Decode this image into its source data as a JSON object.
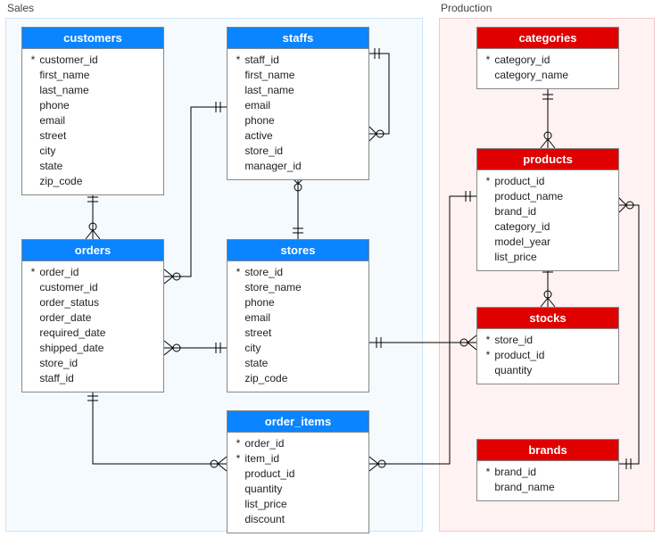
{
  "regions": {
    "sales": {
      "label": "Sales"
    },
    "production": {
      "label": "Production"
    }
  },
  "entities": {
    "customers": {
      "title": "customers",
      "columns": [
        {
          "pk": true,
          "name": "customer_id"
        },
        {
          "pk": false,
          "name": "first_name"
        },
        {
          "pk": false,
          "name": "last_name"
        },
        {
          "pk": false,
          "name": "phone"
        },
        {
          "pk": false,
          "name": "email"
        },
        {
          "pk": false,
          "name": "street"
        },
        {
          "pk": false,
          "name": "city"
        },
        {
          "pk": false,
          "name": "state"
        },
        {
          "pk": false,
          "name": "zip_code"
        }
      ]
    },
    "staffs": {
      "title": "staffs",
      "columns": [
        {
          "pk": true,
          "name": "staff_id"
        },
        {
          "pk": false,
          "name": "first_name"
        },
        {
          "pk": false,
          "name": "last_name"
        },
        {
          "pk": false,
          "name": "email"
        },
        {
          "pk": false,
          "name": "phone"
        },
        {
          "pk": false,
          "name": "active"
        },
        {
          "pk": false,
          "name": "store_id"
        },
        {
          "pk": false,
          "name": "manager_id"
        }
      ]
    },
    "orders": {
      "title": "orders",
      "columns": [
        {
          "pk": true,
          "name": "order_id"
        },
        {
          "pk": false,
          "name": "customer_id"
        },
        {
          "pk": false,
          "name": "order_status"
        },
        {
          "pk": false,
          "name": "order_date"
        },
        {
          "pk": false,
          "name": "required_date"
        },
        {
          "pk": false,
          "name": "shipped_date"
        },
        {
          "pk": false,
          "name": "store_id"
        },
        {
          "pk": false,
          "name": "staff_id"
        }
      ]
    },
    "stores": {
      "title": "stores",
      "columns": [
        {
          "pk": true,
          "name": "store_id"
        },
        {
          "pk": false,
          "name": "store_name"
        },
        {
          "pk": false,
          "name": "phone"
        },
        {
          "pk": false,
          "name": "email"
        },
        {
          "pk": false,
          "name": "street"
        },
        {
          "pk": false,
          "name": "city"
        },
        {
          "pk": false,
          "name": "state"
        },
        {
          "pk": false,
          "name": "zip_code"
        }
      ]
    },
    "order_items": {
      "title": "order_items",
      "columns": [
        {
          "pk": true,
          "name": "order_id"
        },
        {
          "pk": true,
          "name": "item_id"
        },
        {
          "pk": false,
          "name": "product_id"
        },
        {
          "pk": false,
          "name": "quantity"
        },
        {
          "pk": false,
          "name": "list_price"
        },
        {
          "pk": false,
          "name": "discount"
        }
      ]
    },
    "categories": {
      "title": "categories",
      "columns": [
        {
          "pk": true,
          "name": "category_id"
        },
        {
          "pk": false,
          "name": "category_name"
        }
      ]
    },
    "products": {
      "title": "products",
      "columns": [
        {
          "pk": true,
          "name": "product_id"
        },
        {
          "pk": false,
          "name": "product_name"
        },
        {
          "pk": false,
          "name": "brand_id"
        },
        {
          "pk": false,
          "name": "category_id"
        },
        {
          "pk": false,
          "name": "model_year"
        },
        {
          "pk": false,
          "name": "list_price"
        }
      ]
    },
    "stocks": {
      "title": "stocks",
      "columns": [
        {
          "pk": true,
          "name": "store_id"
        },
        {
          "pk": true,
          "name": "product_id"
        },
        {
          "pk": false,
          "name": "quantity"
        }
      ]
    },
    "brands": {
      "title": "brands",
      "columns": [
        {
          "pk": true,
          "name": "brand_id"
        },
        {
          "pk": false,
          "name": "brand_name"
        }
      ]
    }
  },
  "relationships": [
    {
      "from": "customers",
      "to": "orders",
      "type": "one-to-many"
    },
    {
      "from": "staffs",
      "to": "staffs",
      "type": "one-to-many-self"
    },
    {
      "from": "staffs",
      "to": "orders",
      "type": "one-to-many"
    },
    {
      "from": "staffs",
      "to": "stores",
      "type": "many-to-one"
    },
    {
      "from": "stores",
      "to": "orders",
      "type": "one-to-many"
    },
    {
      "from": "orders",
      "to": "order_items",
      "type": "one-to-many"
    },
    {
      "from": "stores",
      "to": "stocks",
      "type": "one-to-many"
    },
    {
      "from": "categories",
      "to": "products",
      "type": "one-to-many"
    },
    {
      "from": "products",
      "to": "stocks",
      "type": "one-to-many"
    },
    {
      "from": "products",
      "to": "order_items",
      "type": "one-to-many"
    },
    {
      "from": "brands",
      "to": "products",
      "type": "one-to-many"
    }
  ],
  "chart_data": {
    "type": "er-diagram",
    "schemas": [
      {
        "name": "Sales",
        "tables": [
          "customers",
          "orders",
          "staffs",
          "stores",
          "order_items"
        ]
      },
      {
        "name": "Production",
        "tables": [
          "categories",
          "products",
          "stocks",
          "brands"
        ]
      }
    ]
  }
}
